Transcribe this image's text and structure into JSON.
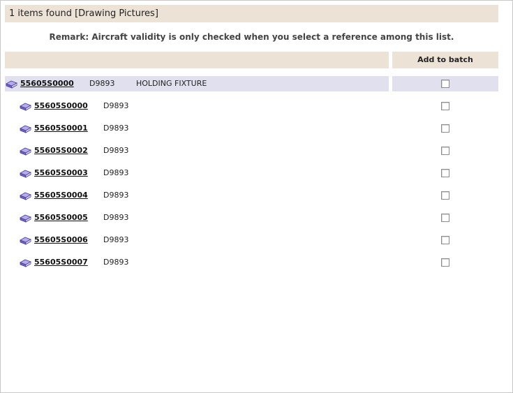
{
  "header": {
    "title": "1 items found [Drawing Pictures]"
  },
  "remark": "Remark: Aircraft validity is only checked when you select a reference among this list.",
  "columns": {
    "add_to_batch": "Add to batch"
  },
  "parent_row": {
    "ref": "55605S0000",
    "code": "D9893",
    "description": "HOLDING FIXTURE",
    "icon": "book-icon",
    "checked": false
  },
  "child_rows": [
    {
      "ref": "55605S0000",
      "code": "D9893",
      "icon": "book-icon",
      "checked": false
    },
    {
      "ref": "55605S0001",
      "code": "D9893",
      "icon": "book-icon",
      "checked": false
    },
    {
      "ref": "55605S0002",
      "code": "D9893",
      "icon": "book-icon",
      "checked": false
    },
    {
      "ref": "55605S0003",
      "code": "D9893",
      "icon": "book-icon",
      "checked": false
    },
    {
      "ref": "55605S0004",
      "code": "D9893",
      "icon": "book-icon",
      "checked": false
    },
    {
      "ref": "55605S0005",
      "code": "D9893",
      "icon": "book-icon",
      "checked": false
    },
    {
      "ref": "55605S0006",
      "code": "D9893",
      "icon": "book-icon",
      "checked": false
    },
    {
      "ref": "55605S0007",
      "code": "D9893",
      "icon": "book-icon",
      "checked": false
    }
  ],
  "colors": {
    "header_bg": "#ece2d6",
    "parent_row_bg": "#e0e0ef",
    "book_cover": "#8a7fd6",
    "book_edge": "#4a3f9a"
  }
}
